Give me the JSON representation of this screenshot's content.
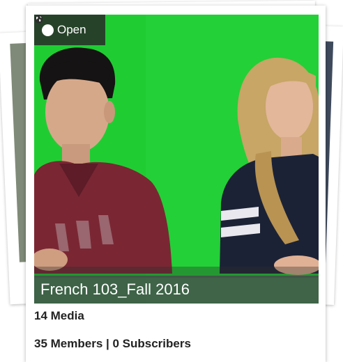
{
  "colors": {
    "backdrop_green": "#1fcd33",
    "badge_bg": "#2c2f2c",
    "caption_bg": "#46484c"
  },
  "card": {
    "badge": {
      "icon": "globe-icon",
      "label": "Open"
    },
    "title": "French 103_Fall 2016",
    "media_count": "14 Media",
    "members_line": "35 Members | 0 Subscribers"
  }
}
